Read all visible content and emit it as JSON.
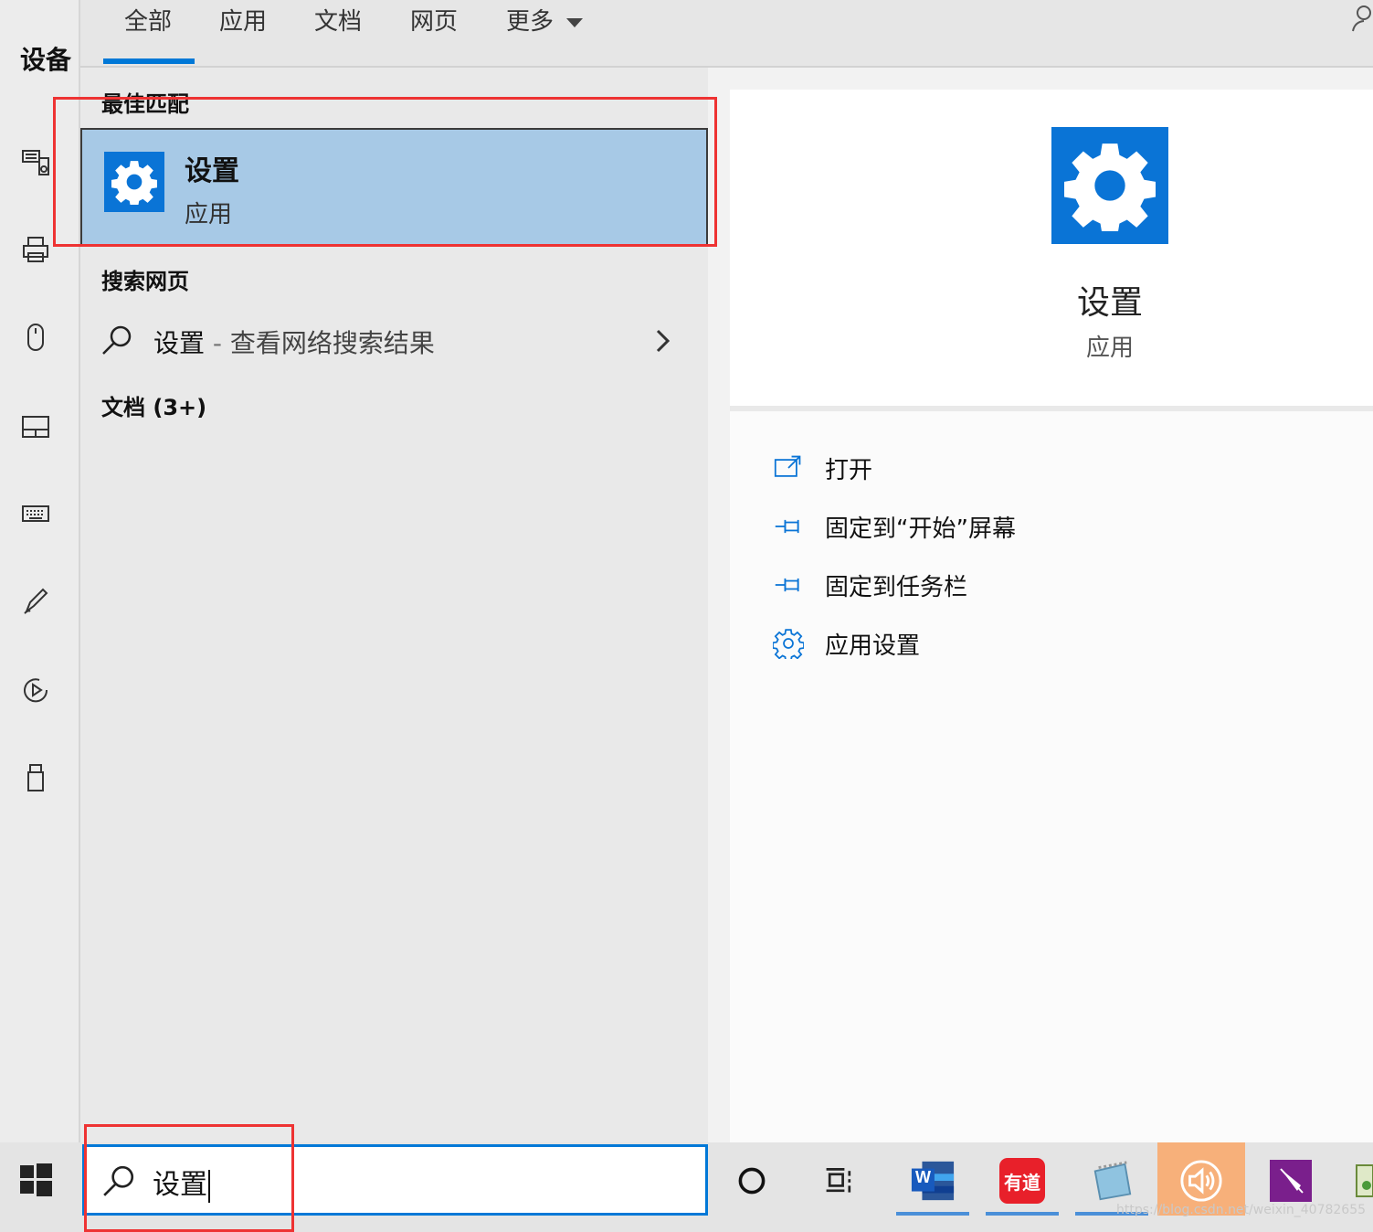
{
  "left_panel": {
    "title": "设备",
    "icons": [
      "keyboard-speaker-icon",
      "printer-icon",
      "mouse-icon",
      "touchpad-icon",
      "keyboard-icon",
      "pen-icon",
      "autoplay-icon",
      "usb-icon"
    ]
  },
  "tabs": [
    {
      "label": "全部",
      "active": true
    },
    {
      "label": "应用",
      "active": false
    },
    {
      "label": "文档",
      "active": false
    },
    {
      "label": "网页",
      "active": false
    },
    {
      "label": "更多",
      "active": false
    }
  ],
  "results": {
    "best_match_heading": "最佳匹配",
    "best_match": {
      "name": "设置",
      "type": "应用"
    },
    "web_heading": "搜索网页",
    "web_result": {
      "query": "设置",
      "separator": " - ",
      "label": "查看网络搜索结果"
    },
    "docs_heading": "文档 (3+)"
  },
  "preview": {
    "name": "设置",
    "type": "应用",
    "actions": [
      {
        "label": "打开",
        "icon": "open-icon"
      },
      {
        "label": "固定到“开始”屏幕",
        "icon": "pin-icon"
      },
      {
        "label": "固定到任务栏",
        "icon": "pin-icon"
      },
      {
        "label": "应用设置",
        "icon": "gear-icon"
      }
    ]
  },
  "taskbar": {
    "search_value": "设置",
    "apps": [
      "cortana-icon",
      "task-view-icon",
      "word-icon",
      "youdao-icon",
      "notepad-icon",
      "volume-icon",
      "pen-app-icon",
      "image-app-icon"
    ],
    "word_letter": "W",
    "youdao_label": "有道",
    "watermark": "https://blog.csdn.net/weixin_40782655"
  },
  "colors": {
    "accent": "#0078d7",
    "selection": "#a7c9e6",
    "annotation": "#e33333"
  }
}
